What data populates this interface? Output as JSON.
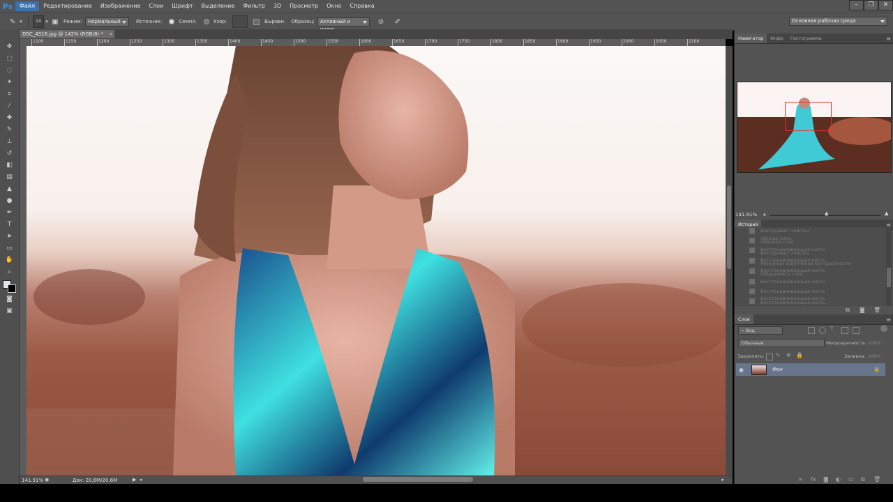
{
  "app": {
    "logo": "Ps"
  },
  "menu": [
    "Файл",
    "Редактирование",
    "Изображение",
    "Слои",
    "Шрифт",
    "Выделение",
    "Фильтр",
    "3D",
    "Просмотр",
    "Окно",
    "Справка"
  ],
  "window_controls": [
    "–",
    "❐",
    "✕"
  ],
  "options": {
    "brush_size": "14",
    "mode_label": "Режим:",
    "mode_value": "Нормальный",
    "source_label": "Источник:",
    "sampled_label": "Семпл.",
    "pattern_label": "Узор:",
    "aligned_label": "Выравн.",
    "sample_label": "Образец:",
    "sample_value": "Активный и ниже",
    "workspace": "Основная рабочая среда"
  },
  "document": {
    "tab_title": "DSC_4316.jpg @ 142% (RGB/8) *",
    "ruler_ticks": [
      "1100",
      "1150",
      "1200",
      "1250",
      "1300",
      "1350",
      "1400",
      "1450",
      "1500",
      "1550",
      "1600",
      "1650",
      "1700",
      "1750",
      "1800",
      "1850",
      "1900",
      "1950",
      "2000",
      "2050",
      "2100"
    ],
    "zoom": "141.91%",
    "doc_size": "Док: 20,6M/20,6M"
  },
  "colors": {
    "chrome": "#535353",
    "accent": "#3b6fae",
    "layer_selected": "#67768c",
    "nav_box": "#e53030"
  },
  "navigator": {
    "tabs": [
      "Навигатор",
      "Инфо",
      "Гистограмма"
    ],
    "zoom": "141.91%"
  },
  "history": {
    "tab": "История",
    "items": [
      "Инструмент «кисть»",
      "Обводка слоя",
      "Восстанавливающая кисть",
      "Восстанавливающая кисть",
      "Восстанавливающая кисть",
      "Восстанавливающая кисть",
      "Восстанавливающая кисть",
      "Восстанавливающая кисть",
      "Восстанавливающая кисть"
    ],
    "overlay_items": [
      "Обнова пикс.",
      "Инструмент «кисть»",
      "Линейное осветление контрастности",
      "Объединить слои"
    ]
  },
  "layers": {
    "tab": "Слои",
    "filter_value": "Вид",
    "blend_mode": "Обычные",
    "opacity_label": "Непрозрачность:",
    "opacity_value": "100%",
    "lock_label": "Закрепить:",
    "fill_label": "Заливка:",
    "fill_value": "100%",
    "items": [
      {
        "name": "Фон"
      }
    ]
  }
}
